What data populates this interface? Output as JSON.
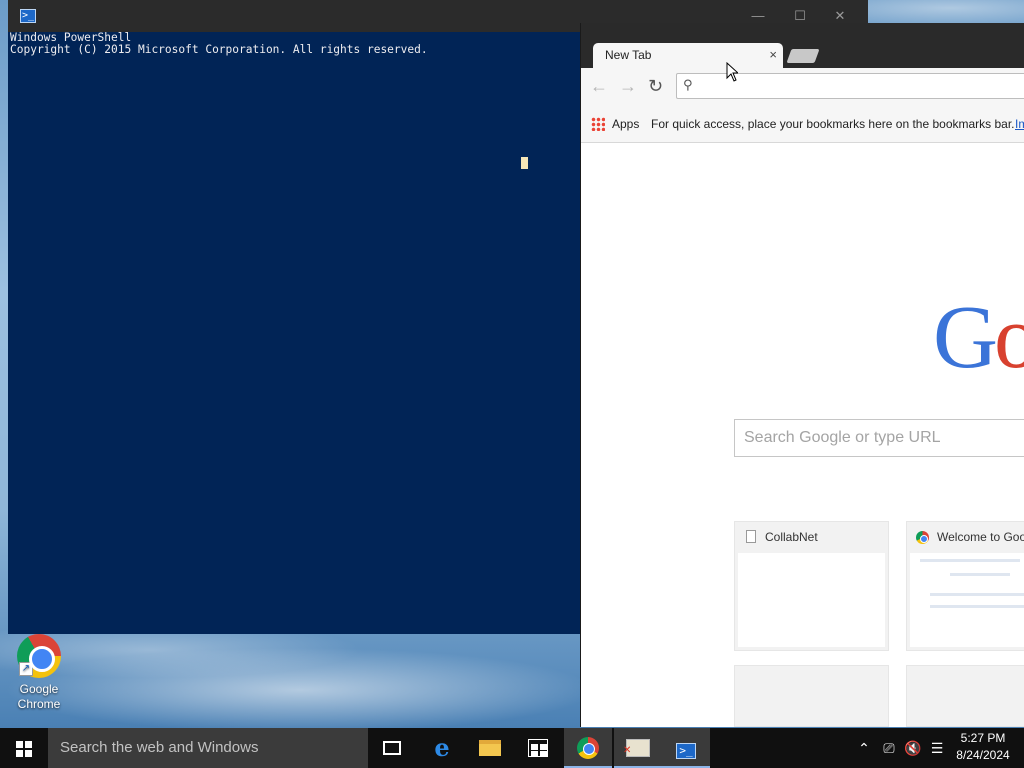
{
  "desktop": {
    "icons": [
      {
        "label_line1": "Google",
        "label_line2": "Chrome"
      }
    ]
  },
  "powershell": {
    "title": "",
    "icon": "powershell-icon",
    "lines": [
      "Windows PowerShell",
      "Copyright (C) 2015 Microsoft Corporation. All rights reserved."
    ],
    "background_color": "#012456"
  },
  "chrome": {
    "tab_title": "New Tab",
    "tab_close": "×",
    "omnibox_value": "",
    "bookmarks": {
      "apps_label": "Apps",
      "hint": "For quick access, place your bookmarks here on the bookmarks bar.",
      "link": "Im"
    },
    "logo_partial": [
      "G",
      "o"
    ],
    "search_placeholder": "Search Google or type URL",
    "tiles": [
      {
        "title": "CollabNet",
        "icon": "document-icon"
      },
      {
        "title": "Welcome to Goo",
        "icon": "chrome-icon"
      }
    ]
  },
  "taskbar": {
    "search_placeholder": "Search the web and Windows",
    "clock_time": "5:27 PM",
    "clock_date": "8/24/2024",
    "pinned": [
      "task-view-icon",
      "edge-icon",
      "file-explorer-icon",
      "store-icon",
      "chrome-icon",
      "image-app-icon",
      "powershell-icon"
    ]
  }
}
